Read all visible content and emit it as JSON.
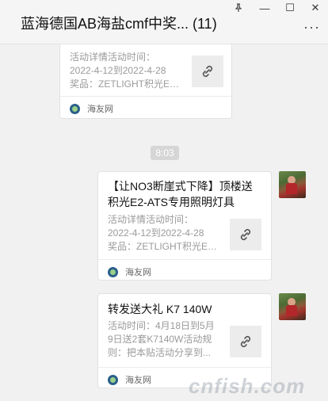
{
  "window": {
    "title": "蓝海德国AB海盐cmf中奖... (11)",
    "pin_icon": "pin-icon",
    "minimize_label": "—",
    "maximize_label": "☐",
    "close_label": "✕",
    "more_label": "···"
  },
  "messages": [
    {
      "desc_lines": [
        "活动详情活动时间：",
        "2022-4-12到2022-4-28",
        "奖品：ZETLIGHT积光E2..."
      ],
      "source": "海友网"
    },
    {
      "title": "【让NO3断崖式下降】顶楼送积光E2-ATS专用照明灯具",
      "desc_lines": [
        "活动详情活动时间：",
        "2022-4-12到2022-4-28",
        "奖品：ZETLIGHT积光E2..."
      ],
      "source": "海友网"
    },
    {
      "title": "转发送大礼 K7 140W",
      "desc_lines": [
        "活动时间：4月18日到5月",
        "9日送2套K7140W活动规",
        "则：把本贴活动分享到..."
      ],
      "source": "海友网"
    }
  ],
  "time_badge": "8:03",
  "watermark": "cnfish.com",
  "colors": {
    "background": "#f1f1f1",
    "card": "#ffffff",
    "badge": "#d6d6d6"
  }
}
